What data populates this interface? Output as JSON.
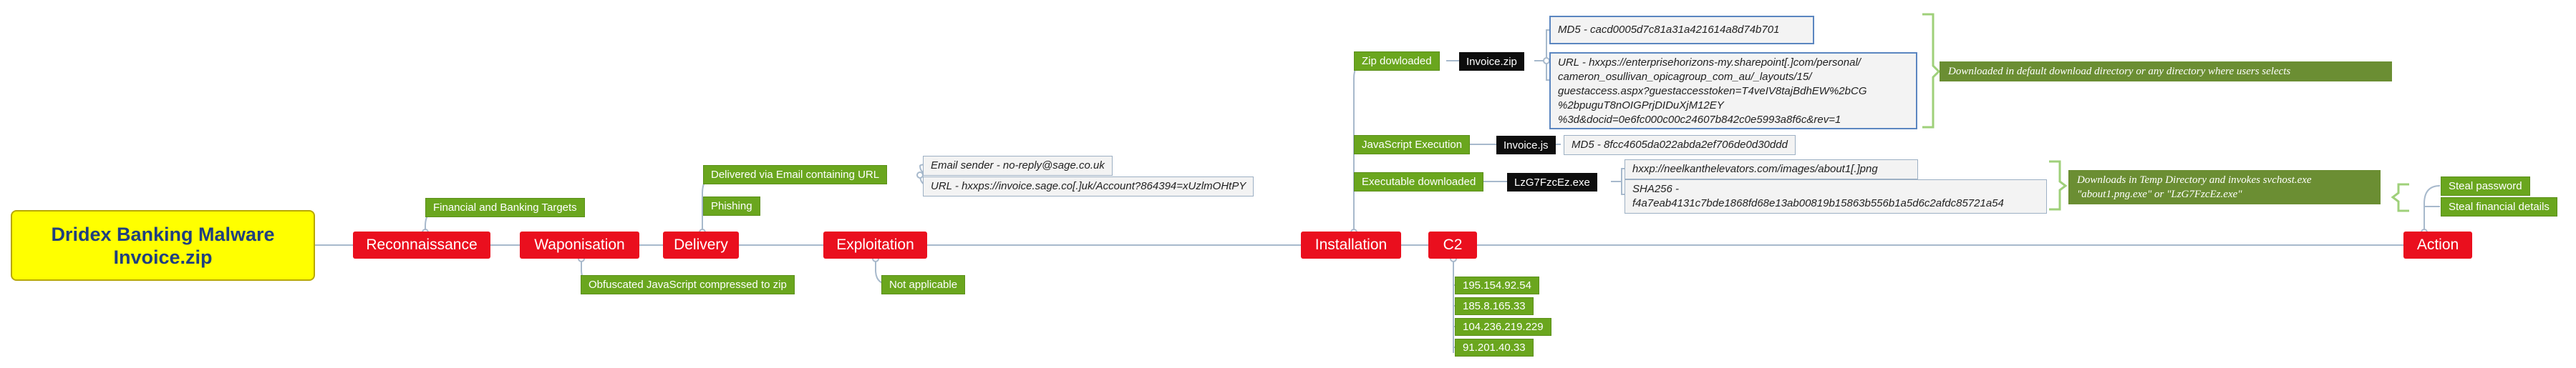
{
  "root": {
    "line1": "Dridex Banking Malware",
    "line2": "Invoice.zip"
  },
  "stages": {
    "reconnaissance": "Reconnaissance",
    "weaponisation": "Waponisation",
    "delivery": "Delivery",
    "exploitation": "Exploitation",
    "installation": "Installation",
    "c2": "C2",
    "action": "Action"
  },
  "reconnaissance": {
    "targets": "Financial and Banking Targets"
  },
  "weaponisation": {
    "obfuscated": "Obfuscated JavaScript compressed to zip"
  },
  "delivery": {
    "email": "Delivered via Email containing URL",
    "phishing": "Phishing",
    "sender": "Email sender - no-reply@sage.co.uk",
    "url": "URL - hxxps://invoice.sage.co[.]uk/Account?864394=xUzlmOHtPY"
  },
  "exploitation": {
    "not_applicable": "Not applicable"
  },
  "installation": {
    "zip_downloaded": "Zip dowloaded",
    "zip_file": "Invoice.zip",
    "zip_md5": "MD5 - cacd0005d7c81a31a421614a8d74b701",
    "zip_url": [
      "URL - hxxps://enterprisehorizons-my.sharepoint[.]com/personal/",
      "cameron_osullivan_opicagroup_com_au/_layouts/15/",
      "guestaccess.aspx?guestaccesstoken=T4veIV8tajBdhEW%2bCG",
      "%2bpuguT8nOIGPrjDIDuXjM12EY",
      "%3d&docid=0e6fc000c00c24607b842c0e5993a8f6c&rev=1"
    ],
    "zip_summary": "Downloaded in default download directory or any directory where users selects",
    "js_execution": "JavaScript Execution",
    "js_file": "Invoice.js",
    "js_md5": "MD5 - 8fcc4605da022abda2ef706de0d30ddd",
    "exe_downloaded": "Executable downloaded",
    "exe_file": "LzG7FzcEz.exe",
    "exe_url": "hxxp://neelkanthelevators.com/images/about1[.]png",
    "exe_sha_label": "SHA256 -",
    "exe_sha": "f4a7eab4131c7bde1868fd68e13ab00819b15863b556b1a5d6c2afdc85721a54",
    "exe_summary": [
      "Downloads in Temp Directory and invokes svchost.exe",
      "\"about1.png.exe\" or \"LzG7FzcEz.exe\""
    ]
  },
  "c2": {
    "ips": [
      "195.154.92.54",
      "185.8.165.33",
      "104.236.219.229",
      "91.201.40.33"
    ]
  },
  "action": {
    "password": "Steal password",
    "financial": "Steal financial details"
  }
}
